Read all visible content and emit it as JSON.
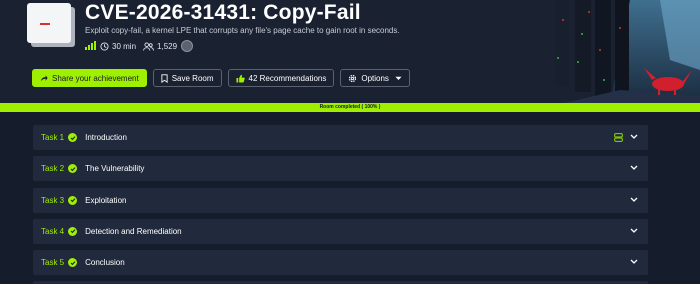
{
  "room": {
    "title": "CVE-2026-31431: Copy-Fail",
    "description": "Exploit copy-fail, a kernel LPE that corrupts any file's page cache to gain root in seconds.",
    "duration": "30 min",
    "users": "1,529"
  },
  "actions": {
    "share_label": "Share your achievement",
    "save_label": "Save Room",
    "recommend_label": "42 Recommendations",
    "options_label": "Options"
  },
  "progress": {
    "label": "Room completed ( 100% )",
    "percent": 100
  },
  "tasks": [
    {
      "number": "Task 1",
      "title": "Introduction"
    },
    {
      "number": "Task 2",
      "title": "The Vulnerability"
    },
    {
      "number": "Task 3",
      "title": "Exploitation"
    },
    {
      "number": "Task 4",
      "title": "Detection and Remediation"
    },
    {
      "number": "Task 5",
      "title": "Conclusion"
    }
  ],
  "colors": {
    "accent": "#9fef00",
    "background": "#151c2b",
    "header": "#1a2131",
    "task_card": "#212a3c"
  },
  "icons": [
    "difficulty-bars-icon",
    "clock-icon",
    "users-icon",
    "share-icon",
    "bookmark-icon",
    "thumbs-up-icon",
    "gear-icon",
    "chevron-down-icon",
    "check-icon",
    "hint-icon"
  ]
}
